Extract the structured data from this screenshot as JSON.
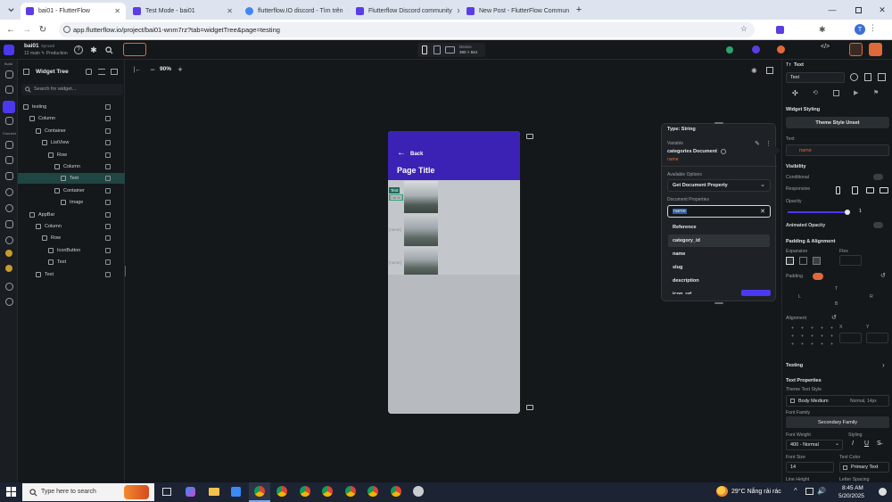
{
  "browser": {
    "tabs": [
      {
        "title": "bai01 - FlutterFlow",
        "active": true,
        "color": "#5b3de5"
      },
      {
        "title": "Test Mode - bai01",
        "active": false,
        "color": "#5b3de5"
      },
      {
        "title": "flutterflow.IO discord - Tìm trên",
        "active": false,
        "color": "#4285f4"
      },
      {
        "title": "Flutterflow Discord community",
        "active": false,
        "color": "#5b3de5"
      },
      {
        "title": "New Post - FlutterFlow Commun",
        "active": false,
        "color": "#5b3de5"
      }
    ],
    "url": "app.flutterflow.io/project/bai01-wnm7rz?tab=widgetTree&page=testing",
    "profile_initial": "T"
  },
  "ff_top": {
    "project_name": "bai01",
    "project_tag": "Synced",
    "project_sub": "12 main  ✎ Production",
    "device_label": "Device",
    "device_size": "390 × 844",
    "zoom": "90%"
  },
  "rail": {
    "build_label": "Build",
    "connect_label": "Connect"
  },
  "tree": {
    "title": "Widget Tree",
    "search_placeholder": "Search for widget...",
    "rows": [
      {
        "label": "testing",
        "indent": 0,
        "selected": false
      },
      {
        "label": "Column",
        "indent": 1,
        "selected": false
      },
      {
        "label": "Container",
        "indent": 2,
        "selected": false
      },
      {
        "label": "ListView",
        "indent": 3,
        "selected": false
      },
      {
        "label": "Row",
        "indent": 4,
        "selected": false
      },
      {
        "label": "Column",
        "indent": 5,
        "selected": false
      },
      {
        "label": "Text",
        "indent": 6,
        "selected": true
      },
      {
        "label": "Container",
        "indent": 5,
        "selected": false
      },
      {
        "label": "Image",
        "indent": 6,
        "selected": false
      },
      {
        "label": "AppBar",
        "indent": 1,
        "selected": false
      },
      {
        "label": "Column",
        "indent": 2,
        "selected": false
      },
      {
        "label": "Row",
        "indent": 3,
        "selected": false
      },
      {
        "label": "IconButton",
        "indent": 4,
        "selected": false
      },
      {
        "label": "Text",
        "indent": 4,
        "selected": false
      },
      {
        "label": "Text",
        "indent": 2,
        "selected": false
      }
    ]
  },
  "phone": {
    "back_label": "Back",
    "page_title": "Page Title",
    "text_badge": "Text",
    "item_labels": [
      "[name]",
      "[name]",
      "[name]"
    ],
    "appbar_color": "#3b22b5"
  },
  "popup": {
    "type_label": "Type: String",
    "variable_caption": "Variable",
    "variable_name": "categories Document",
    "variable_field": "name",
    "available_caption": "Available Options",
    "available_value": "Get Document Property",
    "doc_props_caption": "Document Properties",
    "search_value": "name",
    "options": [
      "Reference",
      "category_id",
      "name",
      "slug",
      "description",
      "icon_url"
    ]
  },
  "props": {
    "header": "Text",
    "widget_name": "Text",
    "widget_styling": "Widget Styling",
    "theme_style_button": "Theme Style Unset",
    "text_label": "Text",
    "text_value": "name",
    "visibility": "Visibility",
    "conditional": "Conditional",
    "responsive": "Responsive",
    "opacity": "Opacity",
    "opacity_value": "1",
    "opacity_fraction": 0.95,
    "animated_opacity": "Animated Opacity",
    "padding_alignment": "Padding & Alignment",
    "expansion": "Expansion",
    "flex": "Flex",
    "padding": "Padding",
    "pad_top": "T",
    "pad_left": "L",
    "pad_right": "R",
    "pad_bottom": "B",
    "alignment": "Alignment",
    "align_x": "X",
    "align_y": "Y",
    "testing": "Testing",
    "text_properties": "Text Properties",
    "theme_text_style": "Theme Text Style",
    "theme_text_value": "Body Medium",
    "theme_text_meta": "Normal, 14px",
    "font_family": "Font Family",
    "font_family_value": "Secondary Family",
    "font_weight": "Font Weight",
    "font_weight_value": "400 - Normal",
    "styling": "Styling",
    "font_size": "Font Size",
    "font_size_value": "14",
    "text_color": "Text Color",
    "text_color_value": "Primary Text",
    "line_height": "Line Height",
    "letter_spacing": "Letter Spacing"
  },
  "taskbar": {
    "search_placeholder": "Type here to search",
    "weather": "29°C  Nắng rải rác",
    "time": "8:45 AM",
    "date": "5/20/2025"
  }
}
